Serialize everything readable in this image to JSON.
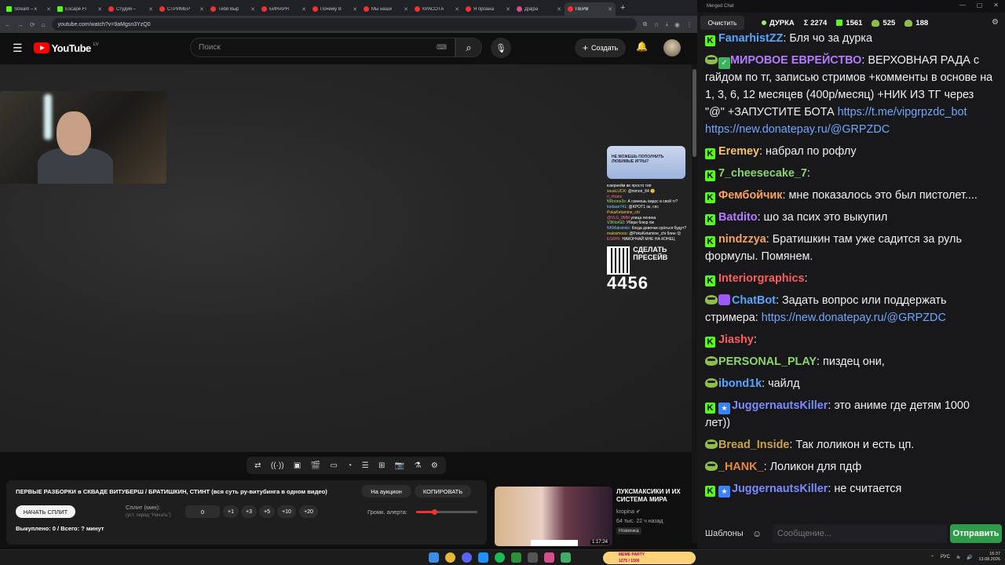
{
  "browser": {
    "tabs": [
      {
        "title": "Stream – k",
        "icon": "kick-icon"
      },
      {
        "title": "Escape Fr",
        "icon": "kick-icon"
      },
      {
        "title": "Студия –",
        "icon": "youtube-icon"
      },
      {
        "title": "СТРИМЕР",
        "icon": "youtube-icon"
      },
      {
        "title": "Тебя Выр",
        "icon": "youtube-icon"
      },
      {
        "title": "БИНАРН",
        "icon": "youtube-icon"
      },
      {
        "title": "Почему В",
        "icon": "youtube-icon"
      },
      {
        "title": "Мы наши",
        "icon": "youtube-icon"
      },
      {
        "title": "КРАСОТА",
        "icon": "youtube-icon"
      },
      {
        "title": "Я проана",
        "icon": "youtube-icon"
      },
      {
        "title": "Д|а|ра",
        "icon": "generic-icon"
      },
      {
        "title": "ПЕРВ",
        "icon": "youtube-icon"
      }
    ],
    "url": "youtube.com/watch?v=9aMgsn3YzQ0",
    "new_tab": "+"
  },
  "youtube": {
    "logo_text": "YouTube",
    "region": "LV",
    "search_placeholder": "Поиск",
    "create_label": "Создать"
  },
  "overlay": {
    "banner": "НЕ МОЖЕШЬ ПОПОЛНИТЬ ЛЮБИМЫЕ ИГРЫ?",
    "chat": [
      {
        "user": "",
        "text": "юзернейм ве просто тип"
      },
      {
        "user": "sousLUCK:",
        "text": "@nimori_84 🙂"
      },
      {
        "user": "ri_rihanz",
        "text": ""
      },
      {
        "user": "NRnone3s:",
        "text": "А скинешь видос в свой тг?"
      },
      {
        "user": "kodaan741:",
        "text": "@KPOT1 ок, спс"
      },
      {
        "user": "PokaKetamine_chi",
        "text": ""
      },
      {
        "user": "@VLG_9MM",
        "text": "улица ленина"
      },
      {
        "user": "V3KtorG0:",
        "text": "Убери блюр пж"
      },
      {
        "user": "NKMaksimiix:",
        "text": "Когда девочки срáться будут?"
      },
      {
        "user": "maksimooo:",
        "text": "@PokaKetamine_chi блин 😮"
      },
      {
        "user": "EGRPk:",
        "text": "НАКОНЧАЙ МНЕ НА КОНЕЦ"
      }
    ],
    "qr_text": "СДЕЛАТЬ ПРЕСЕЙВ",
    "counter": "4456"
  },
  "player_controls": [
    "repeat-icon",
    "wave-icon",
    "captions-icon",
    "clapper-icon",
    "theater-icon",
    "speed-icon",
    "subtitles-icon",
    "screenshot-icon",
    "camera-icon",
    "flask-icon",
    "settings-icon"
  ],
  "video_info": {
    "title": "ПЕРВЫЕ РАЗБОРКИ в СКВАДЕ ВИТУБЕРШ / БРАТИШКИН, СТИНТ (вся суть ру-витубинга в одном видео)",
    "auction_label": "На аукцион",
    "copy_label": "КОПИРОВАТЬ",
    "start_split_label": "НАЧАТЬ СПЛИТ",
    "split_label": "Сплит (мин):",
    "split_hint": "(уст. перед \"Начать\")",
    "split_value": "0",
    "increments": [
      "+1",
      "+3",
      "+5",
      "+10",
      "+20"
    ],
    "volume_label": "Громк. алерта:",
    "volume_level": 0.3,
    "bought": "Выкуплено: 0 / Всего: ? минут"
  },
  "recommended": {
    "title": "ЛУКСМАКСИКИ И ИХ СИСТЕМА МИРА",
    "channel": "kropina",
    "views": "64 тыс.",
    "ago": "22 ч назад",
    "badge": "Новинка",
    "duration": "1:17:24"
  },
  "chat": {
    "window_title": "Merged Chat",
    "clear_label": "Очистить",
    "stats": {
      "name": "ДУРКА",
      "sum": "Σ 2274",
      "kick": "1561",
      "pepe1": "525",
      "pepe2": "188"
    },
    "messages": [
      {
        "badges": [
          "kick"
        ],
        "user": "FanarhistZZ",
        "color": "#53a7ff",
        "text": ": Бля чо за дурка",
        "link": "",
        "link2": ""
      },
      {
        "badges": [
          "pepe",
          "check"
        ],
        "user": "МИРОВОЕ ЕВРЕЙСТВО",
        "color": "#b57bff",
        "text": ": ВЕРХОВНАЯ РАДА с гайдом по тг, записью стримов +комменты в основе на 1, 3, 6, 12 месяцев (400р/месяц) +НИК ИЗ ТГ через \"@\" +ЗАПУСТИТЕ БОТА",
        "link": "https://t.me/vipgrpzdc_bot",
        "link2": "https://new.donatepay.ru/@GRPZDC"
      },
      {
        "badges": [
          "kick"
        ],
        "user": "Eremey",
        "color": "#f7c25e",
        "text": ": набрал по рофлу",
        "link": "",
        "link2": ""
      },
      {
        "badges": [
          "kick"
        ],
        "user": "7_cheesecake_7",
        "color": "#8bd66b",
        "text": ":",
        "link": "",
        "link2": ""
      },
      {
        "badges": [
          "kick"
        ],
        "user": "Фембойчик",
        "color": "#f7a35e",
        "text": ": мне показалось это был пистолет....",
        "link": "",
        "link2": ""
      },
      {
        "badges": [
          "kick"
        ],
        "user": "Batdito",
        "color": "#b57bff",
        "text": ": шо за псих это выкупил",
        "link": "",
        "link2": ""
      },
      {
        "badges": [
          "kick"
        ],
        "user": "nindzzya",
        "color": "#f7a35e",
        "text": ": Братишкин там уже садится за руль формулы. Помянем.",
        "link": "",
        "link2": ""
      },
      {
        "badges": [
          "kick"
        ],
        "user": "Interiorgraphics",
        "color": "#ff5c5c",
        "text": ":",
        "link": "",
        "link2": ""
      },
      {
        "badges": [
          "pepe",
          "bot"
        ],
        "user": "ChatBot",
        "color": "#53a7ff",
        "text": ": Задать вопрос или поддержать стримера:",
        "link": "https://new.donatepay.ru/@GRPZDC",
        "link2": ""
      },
      {
        "badges": [
          "kick"
        ],
        "user": "Jiashy",
        "color": "#ff5c5c",
        "text": ":",
        "link": "",
        "link2": ""
      },
      {
        "badges": [
          "pepe"
        ],
        "user": "PERSONAL_PLAY",
        "color": "#8bd66b",
        "text": ": пиздец они,",
        "link": "",
        "link2": ""
      },
      {
        "badges": [
          "pepe"
        ],
        "user": "ibond1k",
        "color": "#53a7ff",
        "text": ": чайлд",
        "link": "",
        "link2": ""
      },
      {
        "badges": [
          "kick",
          "blue"
        ],
        "user": "JuggernautsKiller",
        "color": "#7b8bff",
        "text": ": это аниме где детям 1000 лет))",
        "link": "",
        "link2": ""
      },
      {
        "badges": [
          "pepe"
        ],
        "user": "Bread_Inside",
        "color": "#c9a24a",
        "text": ": Так лоликон и есть цп.",
        "link": "",
        "link2": ""
      },
      {
        "badges": [
          "pepe"
        ],
        "user": "_HANK_",
        "color": "#e8883c",
        "text": ": Лоликон для пдф",
        "link": "",
        "link2": ""
      },
      {
        "badges": [
          "kick",
          "blue"
        ],
        "user": "JuggernautsKiller",
        "color": "#7b8bff",
        "text": ": не считается",
        "link": "",
        "link2": ""
      }
    ],
    "templates_label": "Шаблоны",
    "input_placeholder": "Сообщение...",
    "send_label": "Отправить"
  },
  "taskbar": {
    "meme_text": "MEME PARTY",
    "meme_progress": "1275 / 1500",
    "lang": "РУС",
    "time": "16:37",
    "date": "13.08.2026"
  }
}
